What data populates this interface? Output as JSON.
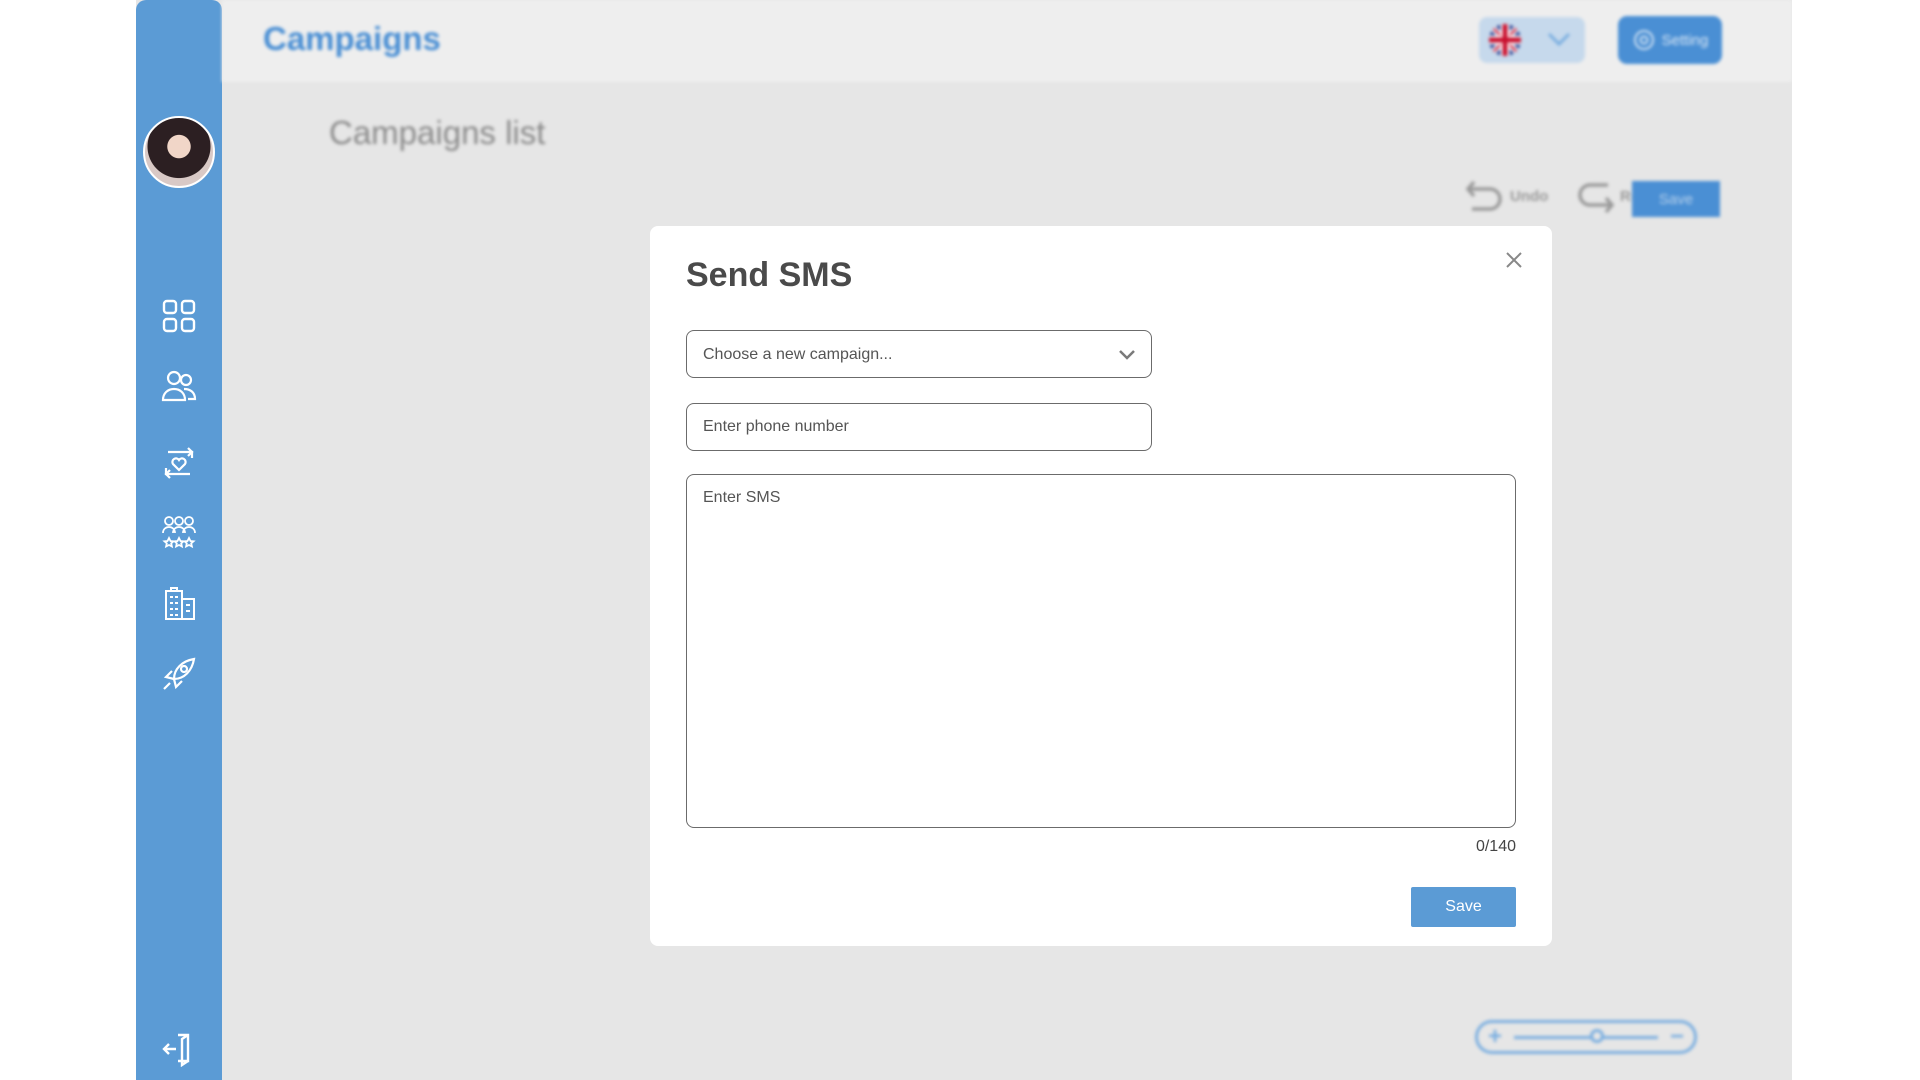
{
  "app": {
    "title": "Campaigns"
  },
  "page": {
    "title": "Campaigns list"
  },
  "header": {
    "setting_label": "Setting",
    "language_flag": "uk-flag-icon"
  },
  "toolbar": {
    "undo_label": "Undo",
    "redo_label": "Redo",
    "save_label": "Save"
  },
  "sidebar": {
    "items": [
      {
        "icon": "dashboard-grid-icon"
      },
      {
        "icon": "users-icon"
      },
      {
        "icon": "loyalty-heart-icon"
      },
      {
        "icon": "groups-stars-icon"
      },
      {
        "icon": "building-icon"
      },
      {
        "icon": "rocket-icon"
      }
    ],
    "logout_icon": "logout-icon"
  },
  "modal": {
    "title": "Send SMS",
    "campaign_placeholder": "Choose a new campaign...",
    "phone_placeholder": "Enter phone number",
    "sms_placeholder": "Enter SMS",
    "counter": "0/140",
    "save_label": "Save"
  },
  "colors": {
    "accent": "#5b9bd5",
    "background": "#e6e6e6"
  }
}
